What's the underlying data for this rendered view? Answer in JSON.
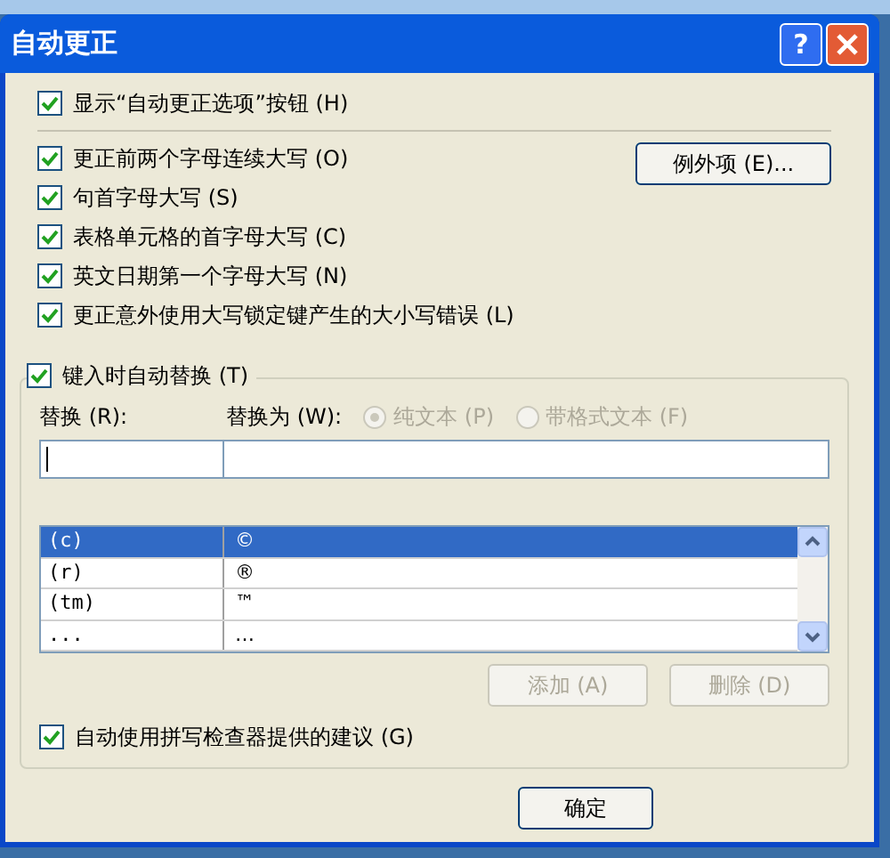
{
  "window": {
    "title": "自动更正",
    "help_button": "?"
  },
  "show_options": {
    "label": "显示“自动更正选项”按钮 (H)",
    "checked": true
  },
  "options": [
    {
      "label": "更正前两个字母连续大写 (O)",
      "checked": true
    },
    {
      "label": "句首字母大写 (S)",
      "checked": true
    },
    {
      "label": "表格单元格的首字母大写 (C)",
      "checked": true
    },
    {
      "label": "英文日期第一个字母大写 (N)",
      "checked": true
    },
    {
      "label": "更正意外使用大写锁定键产生的大小写错误 (L)",
      "checked": true
    }
  ],
  "exceptions_button": "例外项 (E)...",
  "replace_group": {
    "label": "键入时自动替换 (T)",
    "checked": true,
    "replace_label": "替换 (R):",
    "with_label": "替换为 (W):",
    "format": [
      {
        "label": "纯文本 (P)",
        "selected": true,
        "disabled": true
      },
      {
        "label": "带格式文本 (F)",
        "selected": false,
        "disabled": true
      }
    ],
    "rows": [
      {
        "from": "(c)",
        "to": "©",
        "selected": true
      },
      {
        "from": "(r)",
        "to": "®",
        "selected": false
      },
      {
        "from": "(tm)",
        "to": "™",
        "selected": false
      },
      {
        "from": "...",
        "to": "…",
        "selected": false
      }
    ],
    "buttons": [
      {
        "label": "添加 (A)",
        "disabled": true
      },
      {
        "label": "删除 (D)",
        "disabled": true
      }
    ]
  },
  "spelling": {
    "label": "自动使用拼写检查器提供的建议 (G)",
    "checked": true
  },
  "ok_button": "确定"
}
